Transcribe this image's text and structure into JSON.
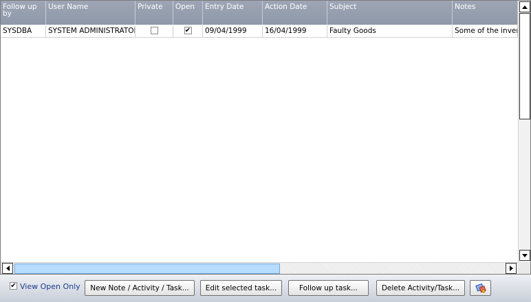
{
  "grid": {
    "columns": [
      "Follow up by",
      "User Name",
      "Private",
      "Open",
      "Entry Date",
      "Action Date",
      "Subject",
      "Notes"
    ],
    "rows": [
      {
        "follow_up_by": "SYSDBA",
        "user_name": "SYSTEM ADMINISTRATOR",
        "private": false,
        "open": true,
        "entry_date": "09/04/1999",
        "action_date": "16/04/1999",
        "subject": "Faulty Goods",
        "notes": "Some of the inventory"
      }
    ]
  },
  "toolbar": {
    "view_open_only_label": "View Open Only",
    "view_open_only_checked": true,
    "new_note_label": "New Note / Activity / Task...",
    "edit_label": "Edit selected task...",
    "follow_up_label": "Follow up task...",
    "delete_label": "Delete Activity/Task...",
    "extra_icon": "eraser-icon"
  },
  "colors": {
    "header_bg": "#949daf",
    "hscroll_thumb": "#b7dcff",
    "checkbox_label": "#1b3b8c"
  }
}
